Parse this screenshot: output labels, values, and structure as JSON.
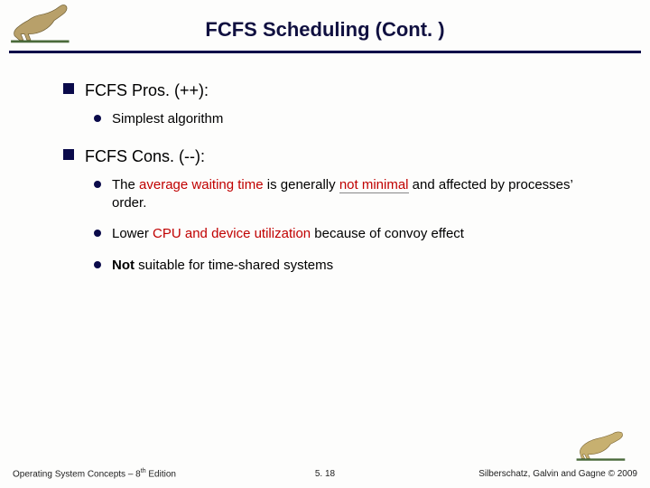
{
  "title": "FCFS Scheduling (Cont. )",
  "bullets": {
    "pros_label": "FCFS Pros. (++):",
    "cons_label": "FCFS Cons. (--):",
    "pros": [
      {
        "text": "Simplest algorithm"
      }
    ],
    "cons_1": {
      "pre": "The ",
      "accent": "average waiting time",
      "mid": " is generally ",
      "nonmin": "not minimal",
      "post": " and affected by processes’ order."
    },
    "cons_2": {
      "pre": "Lower ",
      "accent": "CPU and device utilization",
      "post": "  because of convoy effect"
    },
    "cons_3": {
      "bold": "Not",
      "post": " suitable for time-shared systems"
    }
  },
  "footer": {
    "left_pre": "Operating System Concepts – 8",
    "left_sup": "th",
    "left_post": " Edition",
    "center": "5. 18",
    "right": "Silberschatz, Galvin and Gagne © 2009"
  },
  "icons": {
    "header": "dinosaur-running-icon",
    "footer": "dinosaur-standing-icon"
  }
}
